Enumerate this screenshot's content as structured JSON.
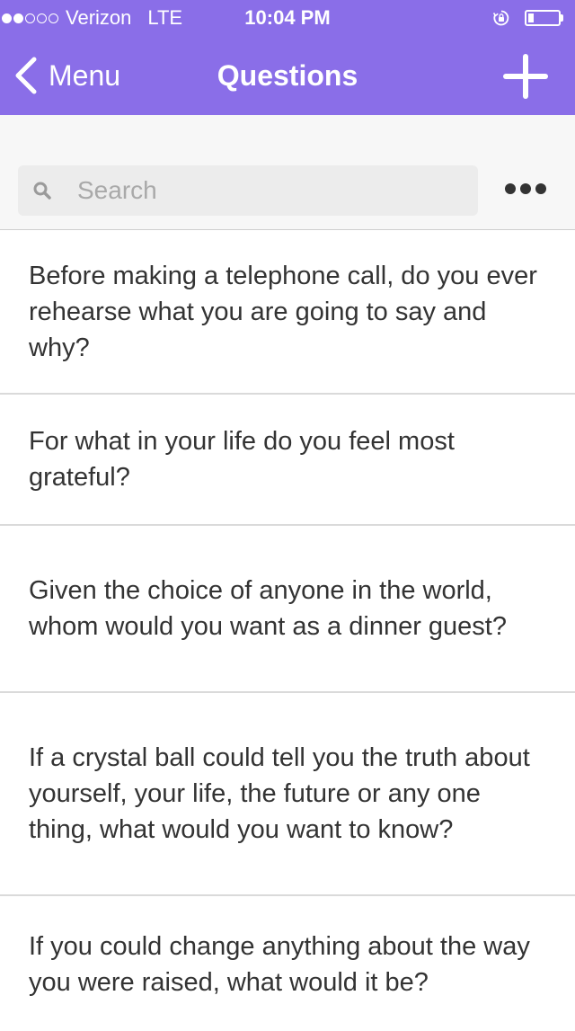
{
  "status_bar": {
    "carrier": "Verizon",
    "network": "LTE",
    "time": "10:04 PM",
    "signal_bars_filled": 2,
    "signal_bars_total": 5,
    "battery_level": 0.2,
    "icons": [
      "rotation-lock-icon",
      "battery-icon"
    ]
  },
  "nav": {
    "back_label": "Menu",
    "title": "Questions",
    "icons": [
      "chevron-left-icon",
      "plus-icon"
    ]
  },
  "search": {
    "placeholder": "Search",
    "value": "",
    "icons": [
      "search-icon",
      "more-dots-icon"
    ]
  },
  "questions": [
    "Before making a telephone call, do you ever rehearse what you are going to say and why?",
    "For what in your life do you feel most grateful?",
    "Given the choice of anyone in the world, whom would you want as a dinner guest?",
    "If a crystal ball could tell you the truth about yourself, your life, the future or any one thing, what would you want to know?",
    "If you could change anything about the way you were raised, what would it be?"
  ],
  "colors": {
    "accent": "#8a6ee8",
    "search_area_bg": "#f7f7f7",
    "search_box_bg": "#ececec",
    "text": "#333333",
    "placeholder": "#a9a9a9"
  }
}
